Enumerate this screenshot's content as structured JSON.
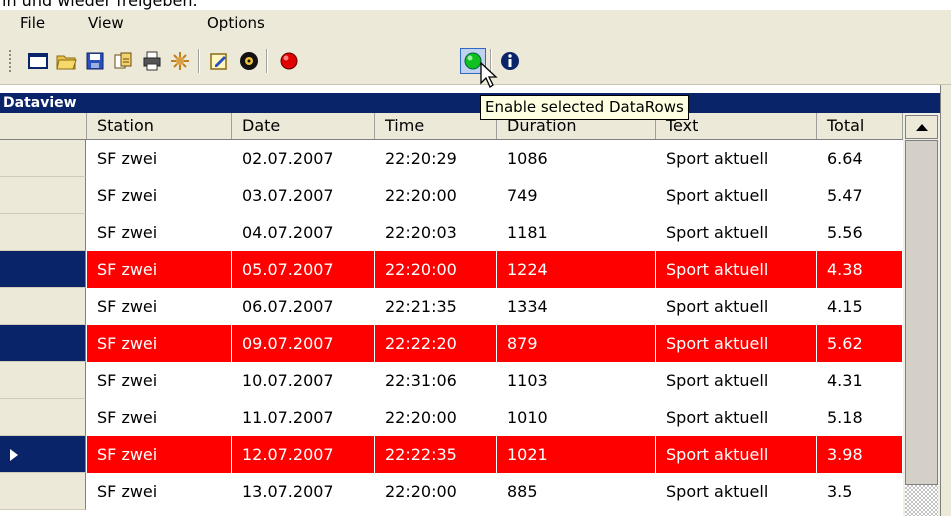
{
  "top_fragment": "in und wieder freigeben.",
  "menu": [
    "File",
    "View",
    "Options"
  ],
  "toolbar": {
    "icons": [
      "new-icon",
      "open-folder-icon",
      "save-icon",
      "export-icon",
      "print-icon",
      "settings-icon",
      "edit-icon",
      "record-disc-icon",
      "disable-rows-icon",
      "enable-rows-icon",
      "info-icon"
    ],
    "pressed": "enable-rows-icon",
    "tooltip": "Enable selected DataRows"
  },
  "grid": {
    "title": "Dataview",
    "columns": [
      "Station",
      "Date",
      "Time",
      "Duration",
      "Text",
      "Total"
    ],
    "rows": [
      {
        "station": "SF zwei",
        "date": "02.07.2007",
        "time": "22:20:29",
        "duration": "1086",
        "text": "Sport aktuell",
        "total": "6.64",
        "selected": false
      },
      {
        "station": "SF zwei",
        "date": "03.07.2007",
        "time": "22:20:00",
        "duration": "749",
        "text": "Sport aktuell",
        "total": "5.47",
        "selected": false
      },
      {
        "station": "SF zwei",
        "date": "04.07.2007",
        "time": "22:20:03",
        "duration": "1181",
        "text": "Sport aktuell",
        "total": "5.56",
        "selected": false
      },
      {
        "station": "SF zwei",
        "date": "05.07.2007",
        "time": "22:20:00",
        "duration": "1224",
        "text": "Sport aktuell",
        "total": "4.38",
        "selected": true
      },
      {
        "station": "SF zwei",
        "date": "06.07.2007",
        "time": "22:21:35",
        "duration": "1334",
        "text": "Sport aktuell",
        "total": "4.15",
        "selected": false
      },
      {
        "station": "SF zwei",
        "date": "09.07.2007",
        "time": "22:22:20",
        "duration": "879",
        "text": "Sport aktuell",
        "total": "5.62",
        "selected": true
      },
      {
        "station": "SF zwei",
        "date": "10.07.2007",
        "time": "22:31:06",
        "duration": "1103",
        "text": "Sport aktuell",
        "total": "4.31",
        "selected": false
      },
      {
        "station": "SF zwei",
        "date": "11.07.2007",
        "time": "22:20:00",
        "duration": "1010",
        "text": "Sport aktuell",
        "total": "5.18",
        "selected": false
      },
      {
        "station": "SF zwei",
        "date": "12.07.2007",
        "time": "22:22:35",
        "duration": "1021",
        "text": "Sport aktuell",
        "total": "3.98",
        "selected": true,
        "current": true
      },
      {
        "station": "SF zwei",
        "date": "13.07.2007",
        "time": "22:20:00",
        "duration": "885",
        "text": "Sport aktuell",
        "total": "3.5",
        "selected": false
      }
    ]
  },
  "colors": {
    "title_bar": "#0a246a",
    "selected_row": "#ff0000",
    "chrome": "#ece9d8"
  }
}
